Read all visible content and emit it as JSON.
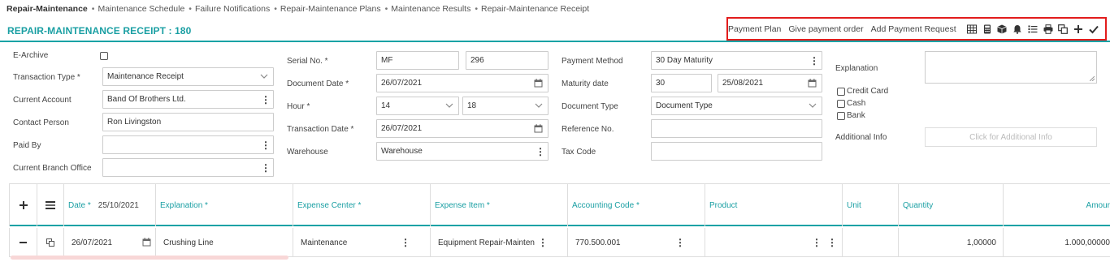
{
  "breadcrumb": {
    "root": "Repair-Maintenance",
    "items": [
      "Maintenance Schedule",
      "Failure Notifications",
      "Repair-Maintenance Plans",
      "Maintenance Results",
      "Repair-Maintenance Receipt"
    ]
  },
  "page": {
    "title": "REPAIR-MAINTENANCE RECEIPT : 180"
  },
  "toolbar": {
    "payment_plan": "Payment Plan",
    "give_payment_order": "Give payment order",
    "add_payment_request": "Add Payment Request",
    "icons": [
      "table-icon",
      "calculator-icon",
      "cube-icon",
      "bell-icon",
      "list-icon",
      "print-icon",
      "copy-icon",
      "plus-icon",
      "check-icon"
    ]
  },
  "form": {
    "e_archive": {
      "label": "E-Archive",
      "checked": false
    },
    "transaction_type": {
      "label": "Transaction Type *",
      "value": "Maintenance Receipt"
    },
    "current_account": {
      "label": "Current Account",
      "value": "Band Of Brothers Ltd."
    },
    "contact_person": {
      "label": "Contact Person",
      "value": "Ron Livingston"
    },
    "paid_by": {
      "label": "Paid By",
      "value": ""
    },
    "current_branch_office": {
      "label": "Current Branch Office",
      "value": ""
    },
    "serial_no": {
      "label": "Serial No. *",
      "series": "MF",
      "number": "296"
    },
    "document_date": {
      "label": "Document Date *",
      "value": "26/07/2021"
    },
    "hour": {
      "label": "Hour *",
      "hour": "14",
      "minute": "18"
    },
    "transaction_date": {
      "label": "Transaction Date *",
      "value": "26/07/2021"
    },
    "warehouse": {
      "label": "Warehouse",
      "value": "Warehouse"
    },
    "payment_method": {
      "label": "Payment Method",
      "value": "30 Day Maturity"
    },
    "maturity_date": {
      "label": "Maturity date",
      "days": "30",
      "date": "25/08/2021"
    },
    "document_type": {
      "label": "Document Type",
      "value": "Document Type"
    },
    "reference_no": {
      "label": "Reference No.",
      "value": ""
    },
    "tax_code": {
      "label": "Tax Code",
      "value": ""
    },
    "explanation": {
      "label": "Explanation",
      "value": ""
    },
    "payment_options": [
      "Credit Card",
      "Cash",
      "Bank"
    ],
    "additional_info": {
      "label": "Additional Info",
      "placeholder": "Click for Additional Info"
    }
  },
  "grid": {
    "columns": {
      "date": "Date *",
      "date_value": "25/10/2021",
      "explanation": "Explanation *",
      "expense_center": "Expense Center *",
      "expense_item": "Expense Item *",
      "accounting_code": "Accounting Code *",
      "product": "Product",
      "unit": "Unit",
      "quantity": "Quantity",
      "amount": "Amour"
    },
    "rows": [
      {
        "date": "26/07/2021",
        "explanation": "Crushing Line",
        "expense_center": "Maintenance",
        "expense_item": "Equipment Repair-Mainten",
        "accounting_code": "770.500.001",
        "product": "",
        "unit": "",
        "quantity": "1,00000",
        "amount": "1.000,00000"
      }
    ]
  },
  "colors": {
    "accent": "#17a2a5",
    "highlight_border": "#e21c1c"
  }
}
